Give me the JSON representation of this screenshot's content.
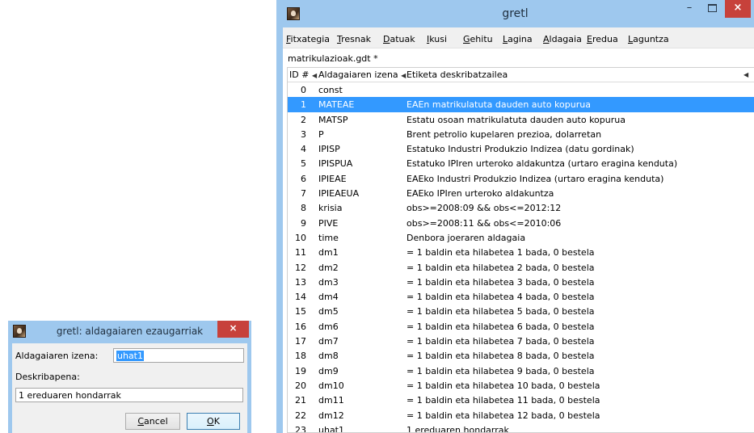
{
  "main_window": {
    "title": "gretl",
    "controls": {
      "minimize": "–",
      "close": "×"
    },
    "menu": [
      {
        "label": "Fitxategia",
        "mnemonic": "F",
        "rest": "itxategia"
      },
      {
        "label": "Tresnak",
        "mnemonic": "T",
        "rest": "resnak"
      },
      {
        "label": "Datuak",
        "mnemonic": "D",
        "rest": "atuak"
      },
      {
        "label": "Ikusi",
        "mnemonic": "I",
        "rest": "kusi"
      },
      {
        "label": "Gehitu",
        "mnemonic": "G",
        "rest": "ehitu"
      },
      {
        "label": "Lagina",
        "mnemonic": "L",
        "rest": "agina"
      },
      {
        "label": "Aldagaia",
        "mnemonic": "A",
        "rest": "ldagaia"
      },
      {
        "label": "Eredua",
        "mnemonic": "E",
        "rest": "redua"
      },
      {
        "label": "Laguntza",
        "mnemonic": "L",
        "rest": "aguntza"
      }
    ],
    "dataset_name": "matrikulazioak.gdt *",
    "table": {
      "headers": {
        "id": "ID #",
        "name": "Aldagaiaren izena",
        "description": "Etiketa deskribatzailea"
      },
      "sort_glyph": "◀",
      "selected_row": 1,
      "rows": [
        {
          "id": "0",
          "name": "const",
          "description": ""
        },
        {
          "id": "1",
          "name": "MATEAE",
          "description": "EAEn matrikulatuta dauden auto kopurua"
        },
        {
          "id": "2",
          "name": "MATSP",
          "description": "Estatu osoan matrikulatuta dauden auto kopurua"
        },
        {
          "id": "3",
          "name": "P",
          "description": "Brent petrolio kupelaren prezioa, dolarretan"
        },
        {
          "id": "4",
          "name": "IPISP",
          "description": "Estatuko Industri Produkzio Indizea (datu gordinak)"
        },
        {
          "id": "5",
          "name": "IPISPUA",
          "description": "Estatuko IPIren urteroko aldakuntza (urtaro eragina kenduta)"
        },
        {
          "id": "6",
          "name": "IPIEAE",
          "description": "EAEko Industri Produkzio Indizea (urtaro eragina kenduta)"
        },
        {
          "id": "7",
          "name": "IPIEAEUA",
          "description": "EAEko IPIren urteroko aldakuntza"
        },
        {
          "id": "8",
          "name": "krisia",
          "description": "obs>=2008:09 && obs<=2012:12"
        },
        {
          "id": "9",
          "name": "PIVE",
          "description": "obs>=2008:11 && obs<=2010:06"
        },
        {
          "id": "10",
          "name": "time",
          "description": "Denbora joeraren aldagaia"
        },
        {
          "id": "11",
          "name": "dm1",
          "description": "= 1 baldin eta hilabetea 1 bada, 0 bestela"
        },
        {
          "id": "12",
          "name": "dm2",
          "description": "= 1 baldin eta hilabetea 2 bada, 0 bestela"
        },
        {
          "id": "13",
          "name": "dm3",
          "description": "= 1 baldin eta hilabetea 3 bada, 0 bestela"
        },
        {
          "id": "14",
          "name": "dm4",
          "description": "= 1 baldin eta hilabetea 4 bada, 0 bestela"
        },
        {
          "id": "15",
          "name": "dm5",
          "description": "= 1 baldin eta hilabetea 5 bada, 0 bestela"
        },
        {
          "id": "16",
          "name": "dm6",
          "description": "= 1 baldin eta hilabetea 6 bada, 0 bestela"
        },
        {
          "id": "17",
          "name": "dm7",
          "description": "= 1 baldin eta hilabetea 7 bada, 0 bestela"
        },
        {
          "id": "18",
          "name": "dm8",
          "description": "= 1 baldin eta hilabetea 8 bada, 0 bestela"
        },
        {
          "id": "19",
          "name": "dm9",
          "description": "= 1 baldin eta hilabetea 9 bada, 0 bestela"
        },
        {
          "id": "20",
          "name": "dm10",
          "description": "= 1 baldin eta hilabetea 10 bada, 0 bestela"
        },
        {
          "id": "21",
          "name": "dm11",
          "description": "= 1 baldin eta hilabetea 11 bada, 0 bestela"
        },
        {
          "id": "22",
          "name": "dm12",
          "description": "= 1 baldin eta hilabetea 12 bada, 0 bestela"
        },
        {
          "id": "23",
          "name": "uhat1",
          "description": "1 ereduaren hondarrak"
        }
      ]
    }
  },
  "dialog": {
    "title": "gretl: aldagaiaren ezaugarriak",
    "close": "×",
    "name_label": "Aldagaiaren izena:",
    "name_value": "uhat1",
    "description_label": "Deskribapena:",
    "description_value": "1 ereduaren hondarrak",
    "cancel": {
      "label": "Cancel",
      "mnemonic": "C",
      "rest": "ancel"
    },
    "ok": {
      "label": "OK",
      "mnemonic": "O",
      "rest": "K"
    }
  },
  "colors": {
    "titlebar": "#9ec8ee",
    "selection": "#3399ff",
    "close_button": "#c7413b"
  }
}
